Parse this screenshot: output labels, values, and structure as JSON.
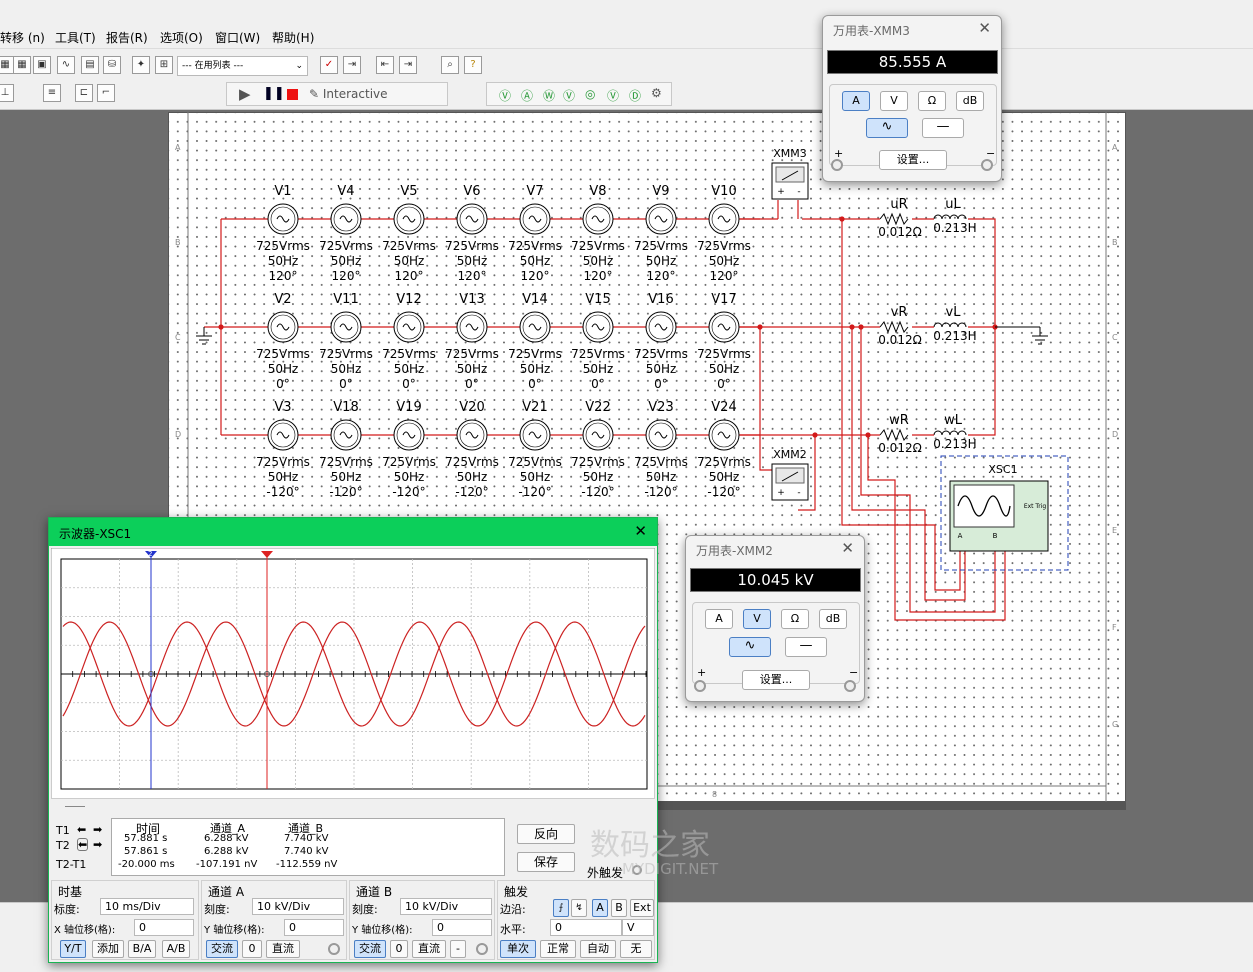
{
  "menu": {
    "items": [
      "转移 (n)",
      "工具(T)",
      "报告(R)",
      "选项(O)",
      "窗口(W)",
      "帮助(H)"
    ]
  },
  "toolbar": {
    "in_use_list": "--- 在用列表 ---",
    "interactive": "Interactive"
  },
  "sheet": {
    "row_marks": [
      "A",
      "B",
      "C",
      "D",
      "E",
      "F",
      "G"
    ],
    "col_marks": [
      "8"
    ]
  },
  "sources": {
    "row1": {
      "names": [
        "V1",
        "V4",
        "V5",
        "V6",
        "V7",
        "V8",
        "V9",
        "V10"
      ],
      "voltage": "725Vrms",
      "freq": "50Hz",
      "phase": "120°"
    },
    "row2": {
      "names": [
        "V2",
        "V11",
        "V12",
        "V13",
        "V14",
        "V15",
        "V16",
        "V17"
      ],
      "voltage": "725Vrms",
      "freq": "50Hz",
      "phase": "0°"
    },
    "row3": {
      "names": [
        "V3",
        "V18",
        "V19",
        "V20",
        "V21",
        "V22",
        "V23",
        "V24"
      ],
      "voltage": "725Vrms",
      "freq": "50Hz",
      "phase": "-120°"
    }
  },
  "loads": [
    {
      "r_name": "uR",
      "r_value": "0.012Ω",
      "l_name": "uL",
      "l_value": "0.213H"
    },
    {
      "r_name": "vR",
      "r_value": "0.012Ω",
      "l_name": "vL",
      "l_value": "0.213H"
    },
    {
      "r_name": "wR",
      "r_value": "0.012Ω",
      "l_name": "wL",
      "l_value": "0.213H"
    }
  ],
  "instruments": {
    "xmm3": "XMM3",
    "xmm2": "XMM2",
    "xsc1": "XSC1",
    "ext_trig": "Ext Trig",
    "a": "A",
    "b": "B"
  },
  "xmm3": {
    "title": "万用表-XMM3",
    "reading": "85.555 A",
    "buttons": [
      "A",
      "V",
      "Ω",
      "dB"
    ],
    "selected": "A",
    "settings": "设置...",
    "plus": "+",
    "minus": "−"
  },
  "xmm2": {
    "title": "万用表-XMM2",
    "reading": "10.045 kV",
    "buttons": [
      "A",
      "V",
      "Ω",
      "dB"
    ],
    "selected": "V",
    "settings": "设置...",
    "plus": "+",
    "minus": "−"
  },
  "osc": {
    "title": "示波器-XSC1",
    "headers": [
      "时间",
      "通道_A",
      "通道_B"
    ],
    "rows": [
      {
        "label": "T1",
        "time": "57.881 s",
        "a": "6.288 kV",
        "b": "7.740 kV"
      },
      {
        "label": "T2",
        "time": "57.861 s",
        "a": "6.288 kV",
        "b": "7.740 kV"
      },
      {
        "label": "T2-T1",
        "time": "-20.000 ms",
        "a": "-107.191 nV",
        "b": "-112.559 nV"
      }
    ],
    "reverse": "反向",
    "save": "保存",
    "ext_trigger": "外触发",
    "timebase": {
      "title": "时基",
      "scale_label": "标度:",
      "scale": "10 ms/Div",
      "xpos_label": "X 轴位移(格):",
      "xpos": "0",
      "btns": [
        "Y/T",
        "添加",
        "B/A",
        "A/B"
      ]
    },
    "chA": {
      "title": "通道 A",
      "scale_label": "刻度:",
      "scale": "10 kV/Div",
      "ypos_label": "Y 轴位移(格):",
      "ypos": "0",
      "btns": [
        "交流",
        "0",
        "直流"
      ]
    },
    "chB": {
      "title": "通道 B",
      "scale_label": "刻度:",
      "scale": "10 kV/Div",
      "ypos_label": "Y 轴位移(格):",
      "ypos": "0",
      "btns": [
        "交流",
        "0",
        "直流",
        "-"
      ]
    },
    "trigger": {
      "title": "触发",
      "edge_label": "边沿:",
      "edge_btns": [
        "A",
        "B",
        "Ext"
      ],
      "level_label": "水平:",
      "level": "0",
      "level_unit": "V",
      "btns": [
        "单次",
        "正常",
        "自动",
        "无"
      ]
    }
  },
  "watermark": {
    "text": "数码之家",
    "sub": "MYDIGIT.NET"
  },
  "colors": {
    "wire": "#d21a1a",
    "grid_green": "#0ccf5a",
    "trace": "#cc2222",
    "cursor_blue": "#2233cc"
  }
}
